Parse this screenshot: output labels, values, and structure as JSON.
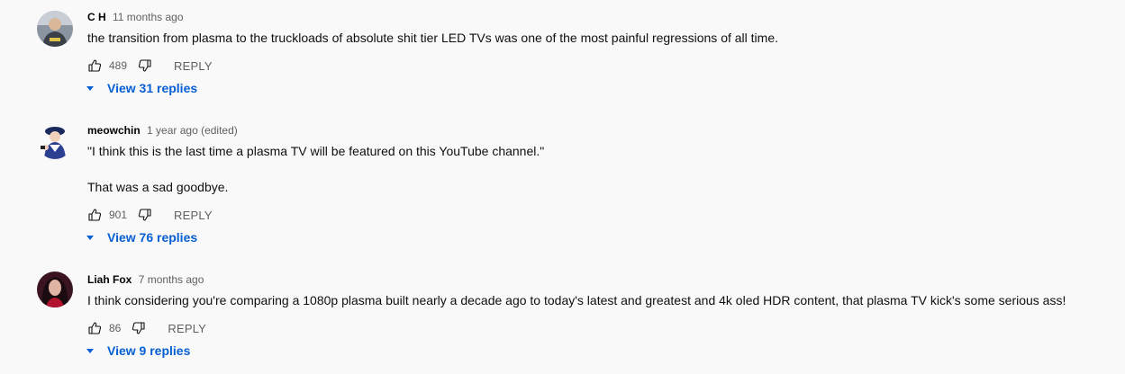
{
  "comments": [
    {
      "author": "C H",
      "time": "11 months ago",
      "text": [
        "the transition from plasma to the truckloads of absolute shit tier LED TVs was one of the most painful regressions of all time."
      ],
      "likes": "489",
      "reply_label": "REPLY",
      "view_replies": "View 31 replies",
      "avatar_icon": "user-avatar-photo"
    },
    {
      "author": "meowchin",
      "time": "1 year ago (edited)",
      "text": [
        "\"I think this is the last time a plasma TV will be featured on this YouTube channel.\"",
        "That was a sad goodbye."
      ],
      "likes": "901",
      "reply_label": "REPLY",
      "view_replies": "View 76 replies",
      "avatar_icon": "user-avatar-cartoon"
    },
    {
      "author": "Liah Fox",
      "time": "7 months ago",
      "text": [
        "I think considering you're comparing a 1080p plasma built nearly a decade ago to today's latest and greatest and 4k oled HDR content, that plasma TV kick's some serious ass!"
      ],
      "likes": "86",
      "reply_label": "REPLY",
      "view_replies": "View 9 replies",
      "avatar_icon": "user-avatar-photo"
    }
  ],
  "colors": {
    "background": "#f9f9f9",
    "link_blue": "#065fd4",
    "secondary_text": "#606060"
  },
  "icons": {
    "like": "thumbs-up-icon",
    "dislike": "thumbs-down-icon",
    "expand": "caret-down-icon"
  }
}
